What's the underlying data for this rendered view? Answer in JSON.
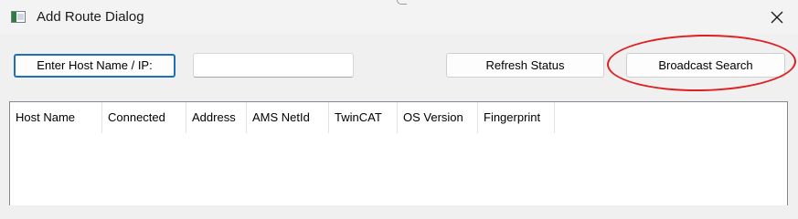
{
  "window": {
    "title": "Add Route Dialog"
  },
  "icons": {
    "app": "app-window-icon",
    "close": "close-icon"
  },
  "controls": {
    "host_label_button": "Enter Host Name / IP:",
    "host_input_value": "",
    "refresh_button": "Refresh Status",
    "broadcast_button": "Broadcast Search"
  },
  "annotation": {
    "highlight_color": "#e02020",
    "highlight_target": "broadcast-search-button"
  },
  "list": {
    "columns": [
      {
        "label": "Host Name"
      },
      {
        "label": "Connected"
      },
      {
        "label": "Address"
      },
      {
        "label": "AMS NetId"
      },
      {
        "label": "TwinCAT"
      },
      {
        "label": "OS Version"
      },
      {
        "label": "Fingerprint"
      }
    ],
    "rows": []
  }
}
